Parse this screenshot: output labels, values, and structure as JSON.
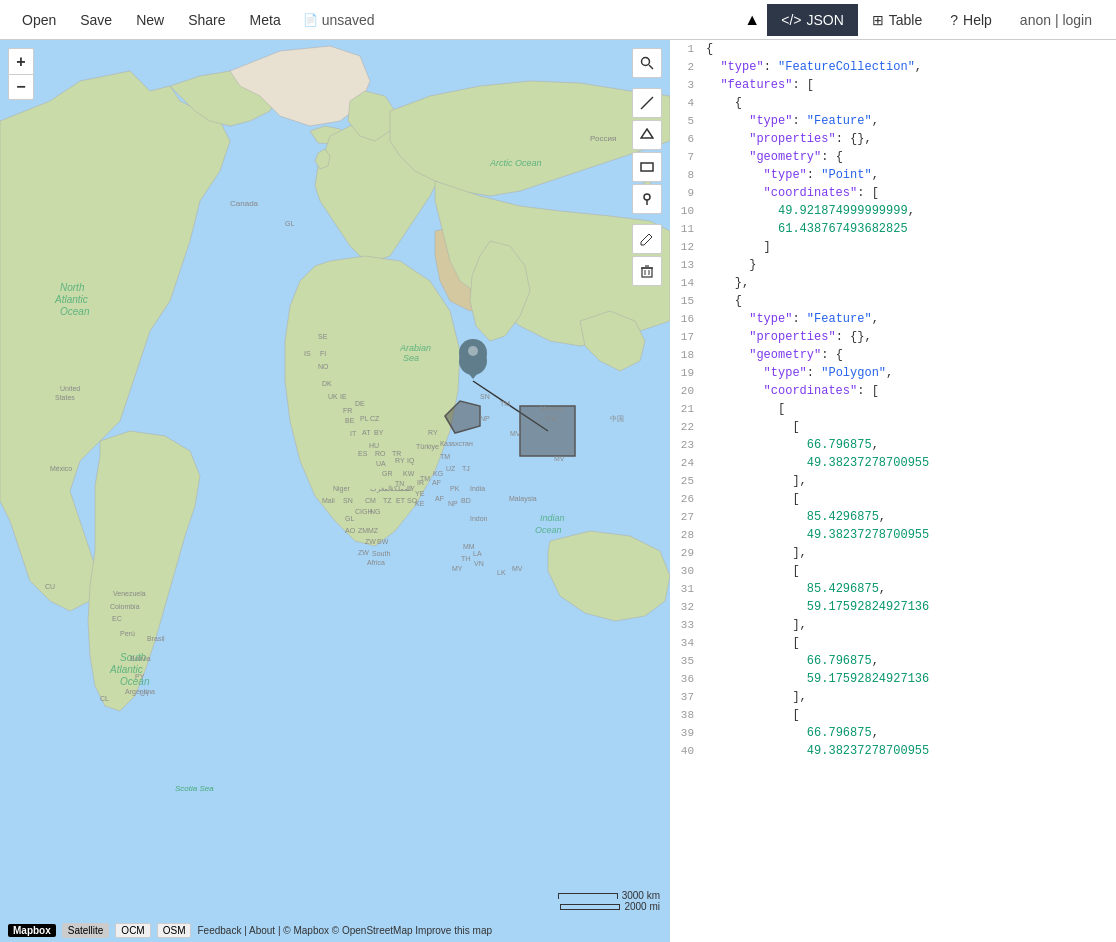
{
  "header": {
    "nav": [
      {
        "label": "Open",
        "id": "open"
      },
      {
        "label": "Save",
        "id": "save"
      },
      {
        "label": "New",
        "id": "new"
      },
      {
        "label": "Share",
        "id": "share"
      },
      {
        "label": "Meta",
        "id": "meta"
      }
    ],
    "unsaved_label": "unsaved",
    "arrow_label": "▲",
    "tabs": [
      {
        "label": "JSON",
        "id": "json",
        "active": true,
        "icon": "</>"
      },
      {
        "label": "Table",
        "id": "table",
        "active": false,
        "icon": "⊞"
      },
      {
        "label": "Help",
        "id": "help",
        "active": false,
        "icon": "?"
      }
    ],
    "auth": "anon | login"
  },
  "map": {
    "zoom_in": "+",
    "zoom_out": "−",
    "scale_km": "3000 km",
    "scale_mi": "2000 mi",
    "attribution_mapbox": "Mapbox",
    "attribution_satellite": "Satellite",
    "attribution_ocm": "OCM",
    "attribution_osm": "OSM",
    "attribution_text": "Feedback | About | © Mapbox © OpenStreetMap Improve this map"
  },
  "toolbar": {
    "tools": [
      {
        "id": "search",
        "icon": "🔍",
        "label": "search"
      },
      {
        "id": "line",
        "icon": "✏",
        "label": "draw-line"
      },
      {
        "id": "polygon",
        "icon": "⬡",
        "label": "draw-polygon"
      },
      {
        "id": "rectangle",
        "icon": "▬",
        "label": "draw-rectangle"
      },
      {
        "id": "point",
        "icon": "📍",
        "label": "draw-point"
      },
      {
        "id": "edit",
        "icon": "✎",
        "label": "edit"
      },
      {
        "id": "delete",
        "icon": "🗑",
        "label": "delete"
      }
    ]
  },
  "json_lines": [
    {
      "num": 1,
      "content": "{",
      "type": "brace"
    },
    {
      "num": 2,
      "content": "  \"type\": \"FeatureCollection\",",
      "parts": [
        {
          "t": "key",
          "v": "\"type\""
        },
        {
          "t": "punct",
          "v": ": "
        },
        {
          "t": "string",
          "v": "\"FeatureCollection\""
        }
      ]
    },
    {
      "num": 3,
      "content": "  \"features\": [",
      "parts": [
        {
          "t": "key",
          "v": "\"features\""
        },
        {
          "t": "punct",
          "v": ": ["
        }
      ]
    },
    {
      "num": 4,
      "content": "    {",
      "type": "brace"
    },
    {
      "num": 5,
      "content": "      \"type\": \"Feature\",",
      "parts": [
        {
          "t": "key",
          "v": "\"type\""
        },
        {
          "t": "punct",
          "v": ": "
        },
        {
          "t": "string",
          "v": "\"Feature\""
        }
      ]
    },
    {
      "num": 6,
      "content": "      \"properties\": {},",
      "parts": [
        {
          "t": "key",
          "v": "\"properties\""
        },
        {
          "t": "punct",
          "v": ": {},"
        }
      ]
    },
    {
      "num": 7,
      "content": "      \"geometry\": {",
      "parts": [
        {
          "t": "key",
          "v": "\"geometry\""
        },
        {
          "t": "punct",
          "v": ": {"
        }
      ]
    },
    {
      "num": 8,
      "content": "        \"type\": \"Point\",",
      "parts": [
        {
          "t": "key",
          "v": "\"type\""
        },
        {
          "t": "punct",
          "v": ": "
        },
        {
          "t": "string",
          "v": "\"Point\""
        }
      ]
    },
    {
      "num": 9,
      "content": "        \"coordinates\": [",
      "parts": [
        {
          "t": "key",
          "v": "\"coordinates\""
        },
        {
          "t": "punct",
          "v": ": ["
        }
      ]
    },
    {
      "num": 10,
      "content": "          49.921874999999999,",
      "parts": [
        {
          "t": "number",
          "v": "49.921874999999999"
        }
      ]
    },
    {
      "num": 11,
      "content": "          61.438767493682825",
      "parts": [
        {
          "t": "number",
          "v": "61.438767493682825"
        }
      ]
    },
    {
      "num": 12,
      "content": "        ]",
      "type": "brace"
    },
    {
      "num": 13,
      "content": "      }",
      "type": "brace"
    },
    {
      "num": 14,
      "content": "    },",
      "type": "brace"
    },
    {
      "num": 15,
      "content": "    {",
      "type": "brace"
    },
    {
      "num": 16,
      "content": "      \"type\": \"Feature\",",
      "parts": [
        {
          "t": "key",
          "v": "\"type\""
        },
        {
          "t": "punct",
          "v": ": "
        },
        {
          "t": "string",
          "v": "\"Feature\""
        }
      ]
    },
    {
      "num": 17,
      "content": "      \"properties\": {},",
      "parts": [
        {
          "t": "key",
          "v": "\"properties\""
        },
        {
          "t": "punct",
          "v": ": {},"
        }
      ]
    },
    {
      "num": 18,
      "content": "      \"geometry\": {",
      "parts": [
        {
          "t": "key",
          "v": "\"geometry\""
        },
        {
          "t": "punct",
          "v": ": {"
        }
      ]
    },
    {
      "num": 19,
      "content": "        \"type\": \"Polygon\",",
      "parts": [
        {
          "t": "key",
          "v": "\"type\""
        },
        {
          "t": "punct",
          "v": ": "
        },
        {
          "t": "string",
          "v": "\"Polygon\""
        }
      ]
    },
    {
      "num": 20,
      "content": "        \"coordinates\": [",
      "parts": [
        {
          "t": "key",
          "v": "\"coordinates\""
        },
        {
          "t": "punct",
          "v": ": ["
        }
      ]
    },
    {
      "num": 21,
      "content": "          [",
      "type": "brace"
    },
    {
      "num": 22,
      "content": "            [",
      "type": "brace"
    },
    {
      "num": 23,
      "content": "              66.796875,",
      "parts": [
        {
          "t": "number",
          "v": "66.796875,"
        }
      ]
    },
    {
      "num": 24,
      "content": "              49.38237278700955",
      "parts": [
        {
          "t": "number",
          "v": "49.38237278700955"
        }
      ]
    },
    {
      "num": 25,
      "content": "            ],",
      "type": "brace"
    },
    {
      "num": 26,
      "content": "            [",
      "type": "brace"
    },
    {
      "num": 27,
      "content": "              85.4296875,",
      "parts": [
        {
          "t": "number",
          "v": "85.4296875,"
        }
      ]
    },
    {
      "num": 28,
      "content": "              49.38237278700955",
      "parts": [
        {
          "t": "number",
          "v": "49.38237278700955"
        }
      ]
    },
    {
      "num": 29,
      "content": "            ],",
      "type": "brace"
    },
    {
      "num": 30,
      "content": "            [",
      "type": "brace"
    },
    {
      "num": 31,
      "content": "              85.4296875,",
      "parts": [
        {
          "t": "number",
          "v": "85.4296875,"
        }
      ]
    },
    {
      "num": 32,
      "content": "              59.17592824927136",
      "parts": [
        {
          "t": "number",
          "v": "59.17592824927136"
        }
      ]
    },
    {
      "num": 33,
      "content": "            ],",
      "type": "brace"
    },
    {
      "num": 34,
      "content": "            [",
      "type": "brace"
    },
    {
      "num": 35,
      "content": "              66.796875,",
      "parts": [
        {
          "t": "number",
          "v": "66.796875,"
        }
      ]
    },
    {
      "num": 36,
      "content": "              59.17592824927136",
      "parts": [
        {
          "t": "number",
          "v": "59.17592824927136"
        }
      ]
    },
    {
      "num": 37,
      "content": "            ],",
      "type": "brace"
    },
    {
      "num": 38,
      "content": "            [",
      "type": "brace"
    },
    {
      "num": 39,
      "content": "              66.796875,",
      "parts": [
        {
          "t": "number",
          "v": "66.796875,"
        }
      ]
    },
    {
      "num": 40,
      "content": "              49.38237278700955",
      "parts": [
        {
          "t": "number",
          "v": "49.38237278700955"
        }
      ]
    }
  ]
}
